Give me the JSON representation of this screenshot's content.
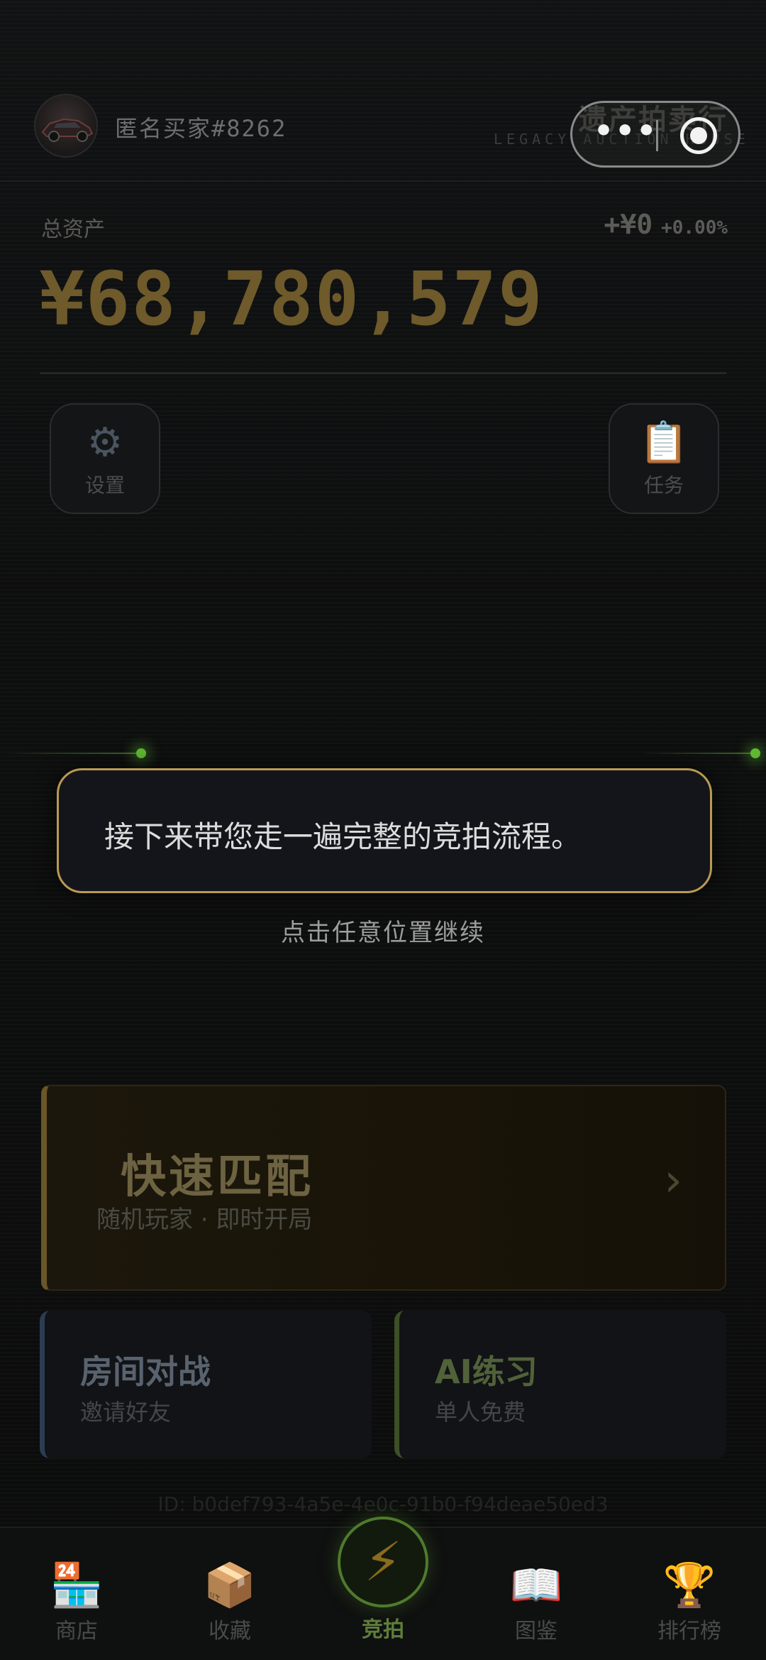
{
  "header": {
    "username": "匿名买家#8262",
    "brand_title": "遗产拍卖行",
    "brand_subtitle": "LEGACY AUCTION HOUSE",
    "more_icon": "more-dots-icon",
    "capsule_dots": "•••",
    "close_icon": "target-circle-icon"
  },
  "assets": {
    "label": "总资产",
    "change_amount": "+¥0",
    "change_percent": "+0.00%",
    "total": "¥68,780,579"
  },
  "shortcuts": {
    "settings": {
      "icon": "⚙",
      "icon_name": "gear-icon",
      "label": "设置"
    },
    "tasks": {
      "icon": "📋",
      "icon_name": "clipboard-icon",
      "label": "任务"
    }
  },
  "guide": {
    "message": "接下来带您走一遍完整的竞拍流程。",
    "continue_hint": "点击任意位置继续"
  },
  "modes": {
    "quick": {
      "title": "快速匹配",
      "subtitle": "随机玩家 · 即时开局",
      "chevron": "›"
    },
    "room": {
      "title": "房间对战",
      "subtitle": "邀请好友"
    },
    "ai": {
      "title": "AI练习",
      "subtitle": "单人免费"
    }
  },
  "user_id": "ID: b0def793-4a5e-4e0c-91b0-f94deae50ed3",
  "tabbar": {
    "shop": {
      "icon": "🏪",
      "label": "商店"
    },
    "collection": {
      "icon": "📦",
      "label": "收藏"
    },
    "auction": {
      "icon": "⚡",
      "label": "竞拍"
    },
    "catalog": {
      "icon": "📖",
      "label": "图鉴"
    },
    "ranking": {
      "icon": "🏆",
      "label": "排行榜"
    }
  },
  "colors": {
    "accent_gold": "#b99a52",
    "accent_green": "#5fb832",
    "background": "#0c0d0d"
  }
}
